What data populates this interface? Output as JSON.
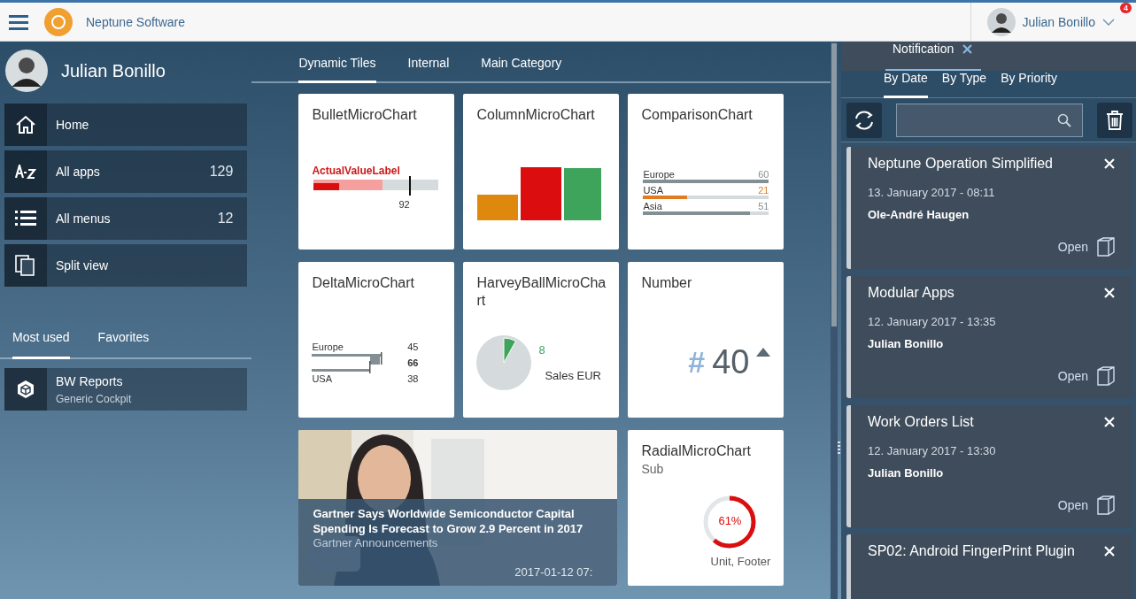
{
  "header": {
    "brand": "Neptune Software",
    "user_name": "Julian Bonillo",
    "badge": "4"
  },
  "sidebar": {
    "user_name": "Julian Bonillo",
    "items": [
      {
        "kind": "home",
        "label": "Home"
      },
      {
        "kind": "az",
        "label": "All apps",
        "count": "129"
      },
      {
        "kind": "list",
        "label": "All menus",
        "count": "12"
      },
      {
        "kind": "split",
        "label": "Split view"
      }
    ],
    "tabs": [
      {
        "label": "Most used",
        "selected": true
      },
      {
        "label": "Favorites",
        "selected": false
      }
    ],
    "apps": [
      {
        "title": "BW Reports",
        "subtitle": "Generic Cockpit"
      }
    ]
  },
  "tabs": [
    {
      "label": "Dynamic Tiles",
      "selected": true
    },
    {
      "label": "Internal",
      "selected": false
    },
    {
      "label": "Main Category",
      "selected": false
    }
  ],
  "tiles": [
    {
      "kind": "bullet",
      "title": "BulletMicroChart",
      "label": "ActualValueLabel",
      "target": "92",
      "level": 0.2
    },
    {
      "kind": "column",
      "title": "ColumnMicroChart"
    },
    {
      "kind": "comparison",
      "title": "ComparisonChart",
      "rows": [
        {
          "label": "Europe",
          "value": "60",
          "color": "#848f94",
          "level": 1
        },
        {
          "label": "USA",
          "value": "21",
          "color": "#e17b24",
          "level": 0.35
        },
        {
          "label": "Asia",
          "value": "51",
          "color": "#848f94",
          "level": 0.85
        }
      ]
    },
    {
      "kind": "delta",
      "title": "DeltaMicroChart",
      "label1": "Europe",
      "value1": "45",
      "delta": "66",
      "label2": "USA",
      "value2": "38"
    },
    {
      "kind": "harvey",
      "title": "HarveyBallMicroChart",
      "value": "8",
      "label": "Sales EUR",
      "level": 0.08
    },
    {
      "kind": "number",
      "title": "Number",
      "symbol": "#",
      "value": "40"
    },
    {
      "kind": "news",
      "title": "Gartner Says Worldwide Semiconductor Capital Spending Is Forecast to Grow 2.9 Percent in 2017",
      "source": "Gartner Announcements",
      "date": "2017-01-12 07:"
    },
    {
      "kind": "radial",
      "title": "RadialMicroChart",
      "subtitle": "Sub",
      "value": "61%",
      "footer": "Unit, Footer",
      "level": 0.61
    }
  ],
  "notifications": {
    "title": "Notification",
    "tabs": [
      {
        "label": "By Date",
        "selected": true
      },
      {
        "label": "By Type",
        "selected": false
      },
      {
        "label": "By Priority",
        "selected": false
      }
    ],
    "cards": [
      {
        "title": "Neptune Operation Simplified",
        "date": "13. January 2017 - 08:11",
        "author": "Ole-André Haugen",
        "action": "Open"
      },
      {
        "title": "Modular Apps",
        "date": "12. January 2017 - 13:35",
        "author": "Julian Bonillo",
        "action": "Open"
      },
      {
        "title": "Work Orders List",
        "date": "12. January 2017 - 13:30",
        "author": "Julian Bonillo",
        "action": "Open"
      },
      {
        "title": "SP02: Android FingerPrint Plugin"
      }
    ]
  }
}
